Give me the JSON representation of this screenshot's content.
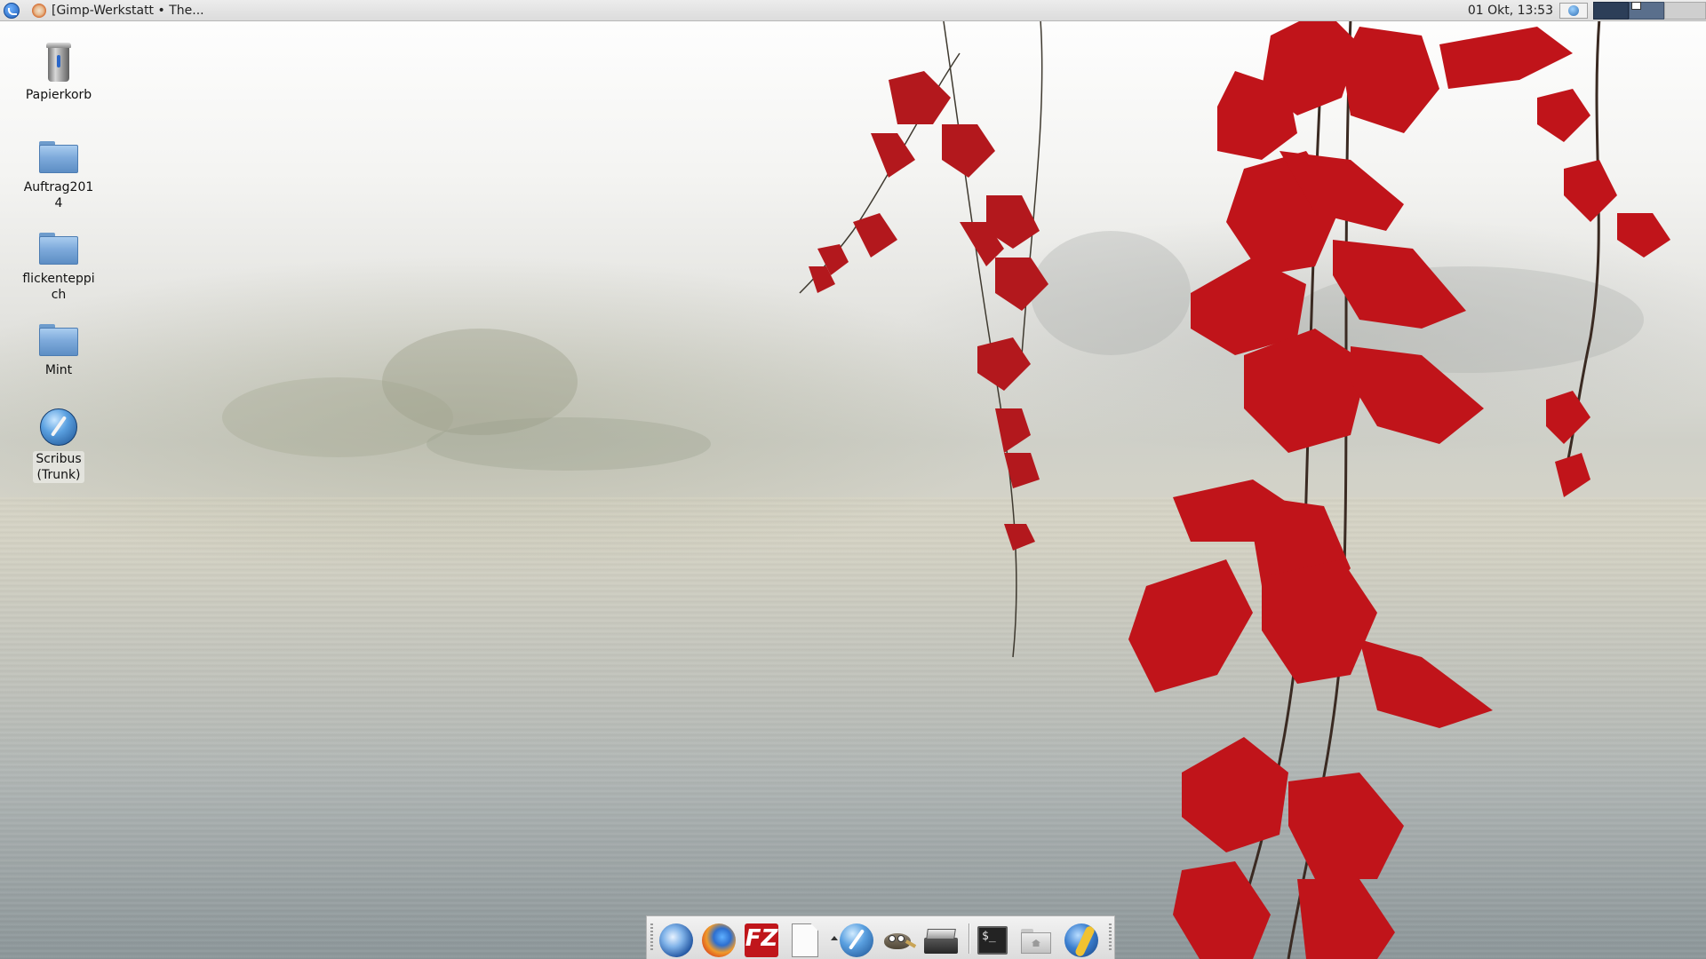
{
  "top_panel": {
    "task_title": "[Gimp-Werkstatt • The...",
    "clock": "01 Okt, 13:53"
  },
  "desktop_icons": [
    {
      "label": "Papierkorb",
      "icon": "trash-icon"
    },
    {
      "label": "Auftrag2014",
      "icon": "folder-icon"
    },
    {
      "label": "flickenteppich",
      "icon": "folder-icon"
    },
    {
      "label": "Mint",
      "icon": "folder-icon"
    },
    {
      "label": "Scribus (Trunk)",
      "icon": "scribus-icon"
    }
  ],
  "dock": [
    {
      "name": "thunderbird-icon"
    },
    {
      "name": "firefox-icon"
    },
    {
      "name": "filezilla-icon",
      "glyph": "FZ"
    },
    {
      "name": "document-icon"
    },
    {
      "name": "scribus-icon"
    },
    {
      "name": "gimp-icon"
    },
    {
      "name": "scanner-icon"
    },
    {
      "name": "terminal-icon",
      "glyph": "$_"
    },
    {
      "name": "home-folder-icon"
    },
    {
      "name": "web-globe-icon"
    }
  ],
  "colors": {
    "leaf_red": "#c0141a",
    "panel_bg": "#e4e4e4",
    "workspace_active": "#2c3e58"
  }
}
